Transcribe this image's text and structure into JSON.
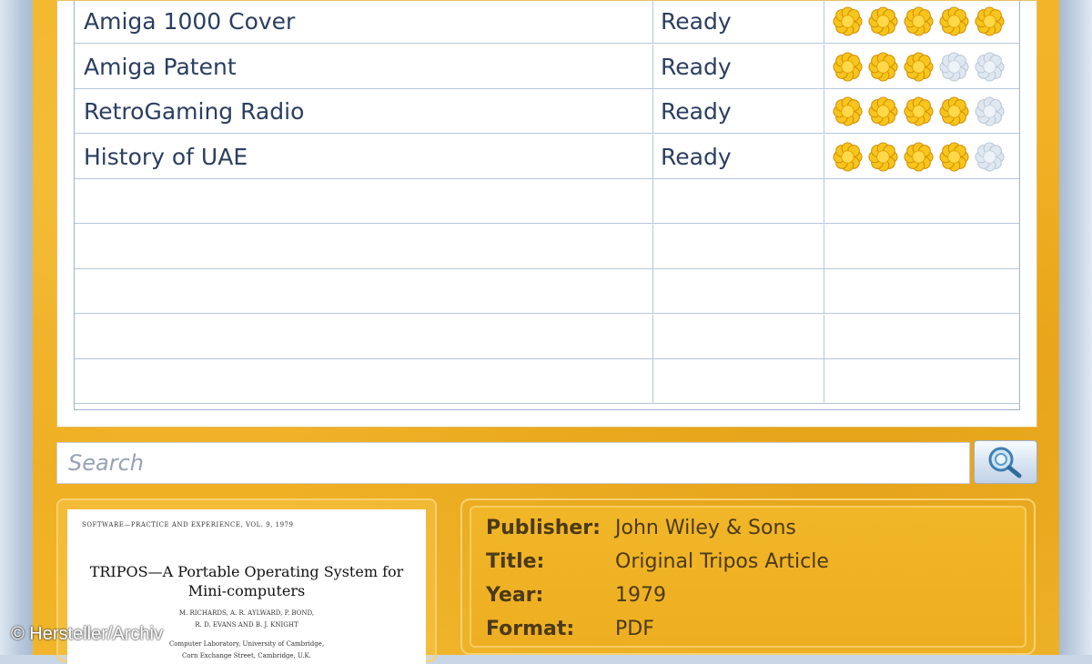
{
  "table": {
    "rows": [
      {
        "name": "Amiga 1000 Cover",
        "status": "Ready",
        "rating": 5
      },
      {
        "name": "Amiga Patent",
        "status": "Ready",
        "rating": 3
      },
      {
        "name": "RetroGaming Radio",
        "status": "Ready",
        "rating": 4
      },
      {
        "name": "History of UAE",
        "status": "Ready",
        "rating": 4
      },
      {
        "name": "",
        "status": "",
        "rating": null
      },
      {
        "name": "",
        "status": "",
        "rating": null
      },
      {
        "name": "",
        "status": "",
        "rating": null
      },
      {
        "name": "",
        "status": "",
        "rating": null
      },
      {
        "name": "",
        "status": "",
        "rating": null
      }
    ],
    "rating_max": 5
  },
  "search": {
    "placeholder": "Search",
    "icon": "search-magnifier-icon"
  },
  "preview": {
    "header": "SOFTWARE—PRACTICE AND EXPERIENCE, VOL. 9, 1979",
    "title_line1": "TRIPOS—A Portable Operating System for",
    "title_line2": "Mini-computers",
    "authors_line1": "M. RICHARDS, A. R. AYLWARD, P. BOND,",
    "authors_line2": "R. D. EVANS AND B. J. KNIGHT",
    "affil_line1": "Computer Laboratory, University of Cambridge,",
    "affil_line2": "Corn Exchange Street, Cambridge, U.K."
  },
  "details": {
    "publisher_label": "Publisher:",
    "publisher": "John Wiley & Sons",
    "title_label": "Title:",
    "title": "Original Tripos Article",
    "year_label": "Year:",
    "year": "1979",
    "format_label": "Format:",
    "format": "PDF"
  },
  "credit": "© Hersteller/Archiv",
  "colors": {
    "background": "#eeab1f",
    "text": "#2b3e61",
    "flower_on": "#f7c51c",
    "flower_off": "#dfe7f0"
  }
}
